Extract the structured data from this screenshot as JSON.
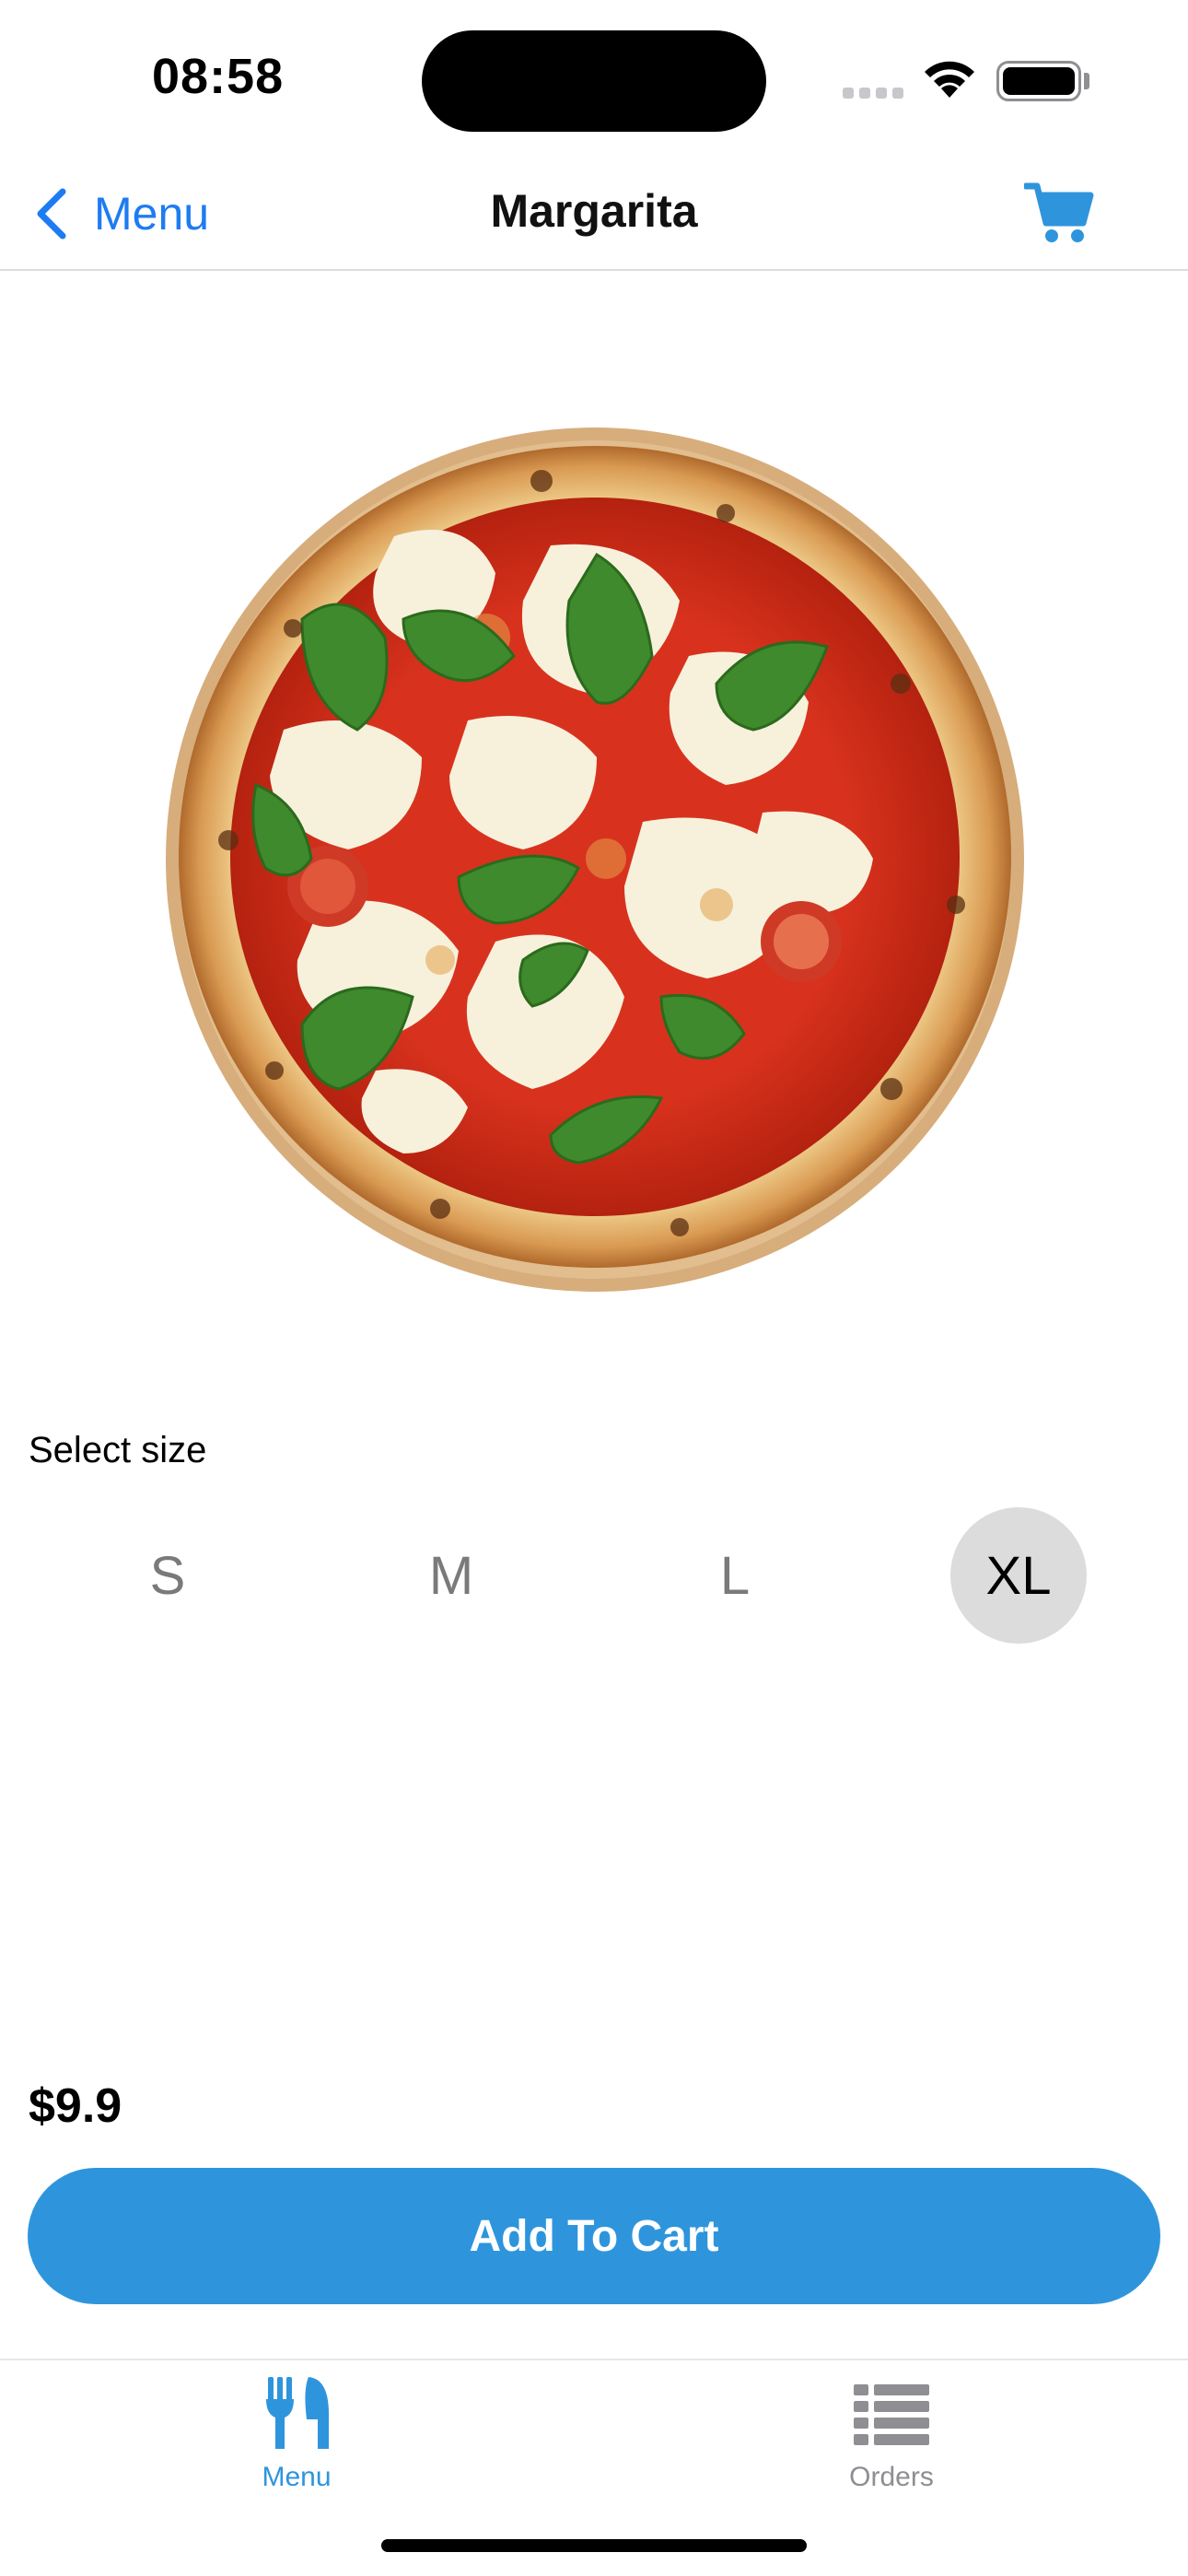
{
  "status_bar": {
    "time": "08:58"
  },
  "nav": {
    "back_label": "Menu",
    "title": "Margarita"
  },
  "product": {
    "image_alt": "Margarita pizza",
    "size_label": "Select size",
    "sizes": [
      "S",
      "M",
      "L",
      "XL"
    ],
    "selected_size": "XL",
    "price": "$9.9",
    "add_to_cart_label": "Add To Cart"
  },
  "tab_bar": {
    "tabs": [
      {
        "label": "Menu",
        "icon": "fork-knife-icon",
        "active": true
      },
      {
        "label": "Orders",
        "icon": "list-icon",
        "active": false
      }
    ]
  },
  "colors": {
    "accent": "#1e7cf2",
    "button": "#2e95dd",
    "selected_size_bg": "#dcdcdc"
  }
}
